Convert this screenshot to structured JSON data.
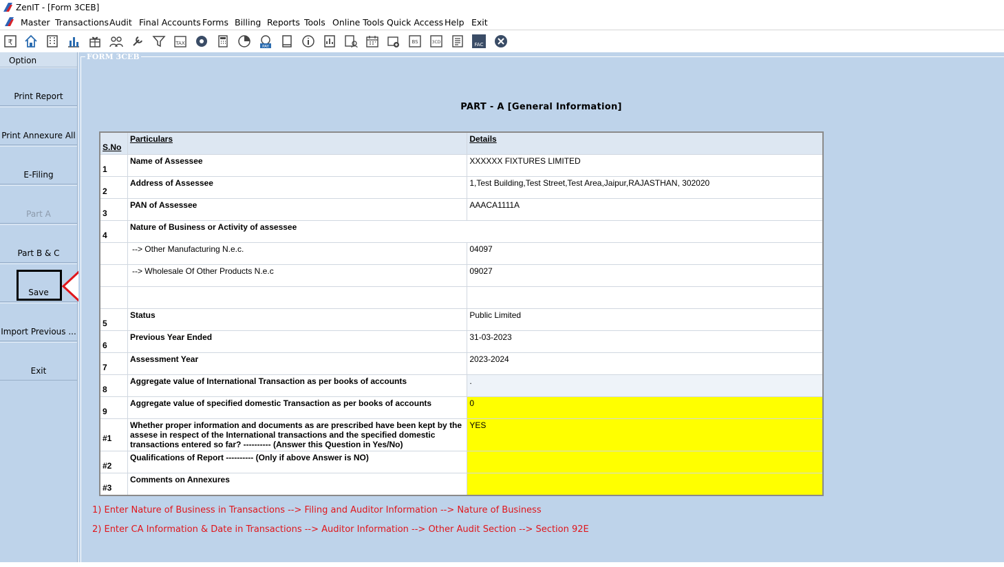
{
  "window": {
    "title": "ZenIT - [Form 3CEB]"
  },
  "menu": [
    "Master",
    "Transactions",
    "Audit",
    "Final Accounts",
    "Forms",
    "Billing",
    "Reports",
    "Tools",
    "Online Tools",
    "Quick Access",
    "Help",
    "Exit"
  ],
  "toolbar_icons": [
    "rupee-icon",
    "home-icon",
    "building-icon",
    "bar-chart-icon",
    "gift-icon",
    "users-icon",
    "wrench-icon",
    "filter-icon",
    "tax-icon",
    "disc-icon",
    "calculator-icon",
    "pie-icon",
    "pay-icon",
    "book-icon",
    "info-icon",
    "report-icon",
    "person-report-icon",
    "calendar-icon",
    "calendar-add-icon",
    "bs-icon",
    "3cd-icon",
    "sheet-icon",
    "fac-icon",
    "close-icon"
  ],
  "sidebar": {
    "option": "Option",
    "buttons": [
      "Print Report",
      "Print Annexure All",
      "E-Filing",
      "Part A",
      "Part B & C",
      "Save",
      "Import Previous ...",
      "Exit"
    ]
  },
  "form": {
    "frame_label": "FORM 3CEB",
    "part_title": "PART - A [General  Information]",
    "headers": {
      "sno": "S.No",
      "particulars": "Particulars",
      "details": "Details"
    },
    "rows": [
      {
        "sno": "1",
        "particulars": "Name of Assessee",
        "details": "XXXXXX FIXTURES LIMITED"
      },
      {
        "sno": "2",
        "particulars": "Address of Assessee",
        "details": "1,Test Building,Test Street,Test Area,Jaipur,RAJASTHAN, 302020"
      },
      {
        "sno": "3",
        "particulars": "PAN of Assessee",
        "details": "AAACA1111A"
      },
      {
        "sno": "4",
        "particulars": "Nature of Business or Activity of assessee",
        "details": ""
      },
      {
        "sno": "",
        "particulars": "--> Other Manufacturing N.e.c.",
        "details": "04097"
      },
      {
        "sno": "",
        "particulars": "--> Wholesale Of Other Products N.e.c",
        "details": "09027"
      },
      {
        "sno": "",
        "particulars": "",
        "details": ""
      },
      {
        "sno": "5",
        "particulars": "Status",
        "details": "Public Limited"
      },
      {
        "sno": "6",
        "particulars": "Previous Year Ended",
        "details": "31-03-2023"
      },
      {
        "sno": "7",
        "particulars": "Assessment Year",
        "details": "2023-2024"
      },
      {
        "sno": "8",
        "particulars": "Aggregate value of International Transaction as per books of accounts",
        "details": "."
      },
      {
        "sno": "9",
        "particulars": "Aggregate value of specified domestic Transaction as per books of accounts",
        "details": "0"
      },
      {
        "sno": "#1",
        "particulars": "Whether proper information and documents as are prescribed have been kept by the assese in respect of the International transactions and the specified domestic transactions entered so far? ---------- (Answer this Question in Yes/No)",
        "details": "YES"
      },
      {
        "sno": "#2",
        "particulars": "Qualifications of Report ---------- (Only if above Answer is NO)",
        "details": ""
      },
      {
        "sno": "#3",
        "particulars": "Comments on Annexures",
        "details": ""
      }
    ]
  },
  "notes": [
    "1) Enter Nature of Business in Transactions --> Filing and Auditor Information --> Nature of Business",
    "2) Enter CA Information & Date in Transactions --> Auditor Information --> Other Audit Section --> Section 92E"
  ],
  "colors": {
    "panel": "#bed3ea",
    "highlight": "#ffff00",
    "note": "#e0161b",
    "arrow": "#e0161b"
  }
}
